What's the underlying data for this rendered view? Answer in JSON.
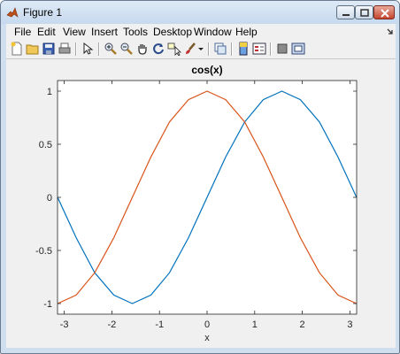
{
  "window": {
    "title": "Figure 1"
  },
  "menu": [
    "File",
    "Edit",
    "View",
    "Insert",
    "Tools",
    "Desktop",
    "Window",
    "Help"
  ],
  "toolbar_icons": [
    "new-figure-icon",
    "open-file-icon",
    "save-icon",
    "print-icon",
    "select-arrow-icon",
    "zoom-in-icon",
    "zoom-out-icon",
    "pan-hand-icon",
    "rotate-3d-icon",
    "data-cursor-icon",
    "brush-icon",
    "brush-dropdown-icon",
    "link-plot-icon",
    "insert-colorbar-icon",
    "insert-legend-icon",
    "hide-plot-tools-icon",
    "show-plot-tools-icon"
  ],
  "chart_data": {
    "type": "line",
    "title": "cos(x)",
    "xlabel": "x",
    "ylabel": "",
    "xlim": [
      -3.14159,
      3.14159
    ],
    "ylim": [
      -1.1,
      1.1
    ],
    "xticks": [
      -3,
      -2,
      -1,
      0,
      1,
      2,
      3
    ],
    "yticks": [
      -1,
      -0.5,
      0,
      0.5,
      1
    ],
    "xtick_labels": [
      "-3",
      "-2",
      "-1",
      "0",
      "1",
      "2",
      "3"
    ],
    "ytick_labels": [
      "-1",
      "-0.5",
      "0",
      "0.5",
      "1"
    ],
    "grid": false,
    "series": [
      {
        "color": "#0072BD",
        "x": [
          -3.14,
          -2.75,
          -2.36,
          -1.96,
          -1.57,
          -1.18,
          -0.79,
          -0.39,
          0,
          0.39,
          0.79,
          1.18,
          1.57,
          1.96,
          2.36,
          2.75,
          3.14
        ],
        "y": [
          0,
          -0.38,
          -0.71,
          -0.92,
          -1,
          -0.92,
          -0.71,
          -0.38,
          0,
          0.38,
          0.71,
          0.92,
          1,
          0.92,
          0.71,
          0.38,
          0
        ]
      },
      {
        "color": "#D95319",
        "x": [
          -3.14,
          -2.75,
          -2.36,
          -1.96,
          -1.57,
          -1.18,
          -0.79,
          -0.39,
          0,
          0.39,
          0.79,
          1.18,
          1.57,
          1.96,
          2.36,
          2.75,
          3.14
        ],
        "y": [
          -1,
          -0.92,
          -0.71,
          -0.38,
          0,
          0.38,
          0.71,
          0.92,
          1,
          0.92,
          0.71,
          0.38,
          0,
          -0.38,
          -0.71,
          -0.92,
          -1
        ]
      }
    ]
  }
}
